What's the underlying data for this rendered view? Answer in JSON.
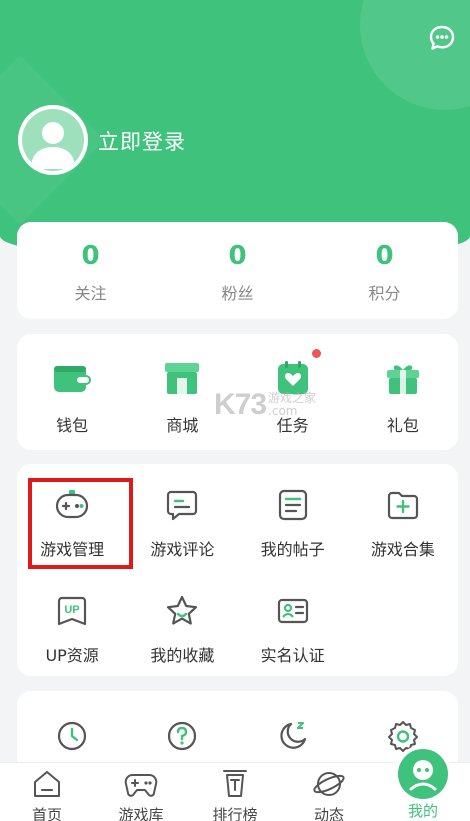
{
  "header": {
    "login_text": "立即登录",
    "accent_color": "#3ec27c",
    "message_icon": "chat-bubble-icon"
  },
  "stats": [
    {
      "value": "0",
      "label": "关注"
    },
    {
      "value": "0",
      "label": "粉丝"
    },
    {
      "value": "0",
      "label": "积分"
    }
  ],
  "wallet_row": [
    {
      "label": "钱包",
      "icon": "wallet-icon"
    },
    {
      "label": "商城",
      "icon": "shop-icon"
    },
    {
      "label": "任务",
      "icon": "task-icon",
      "badge_dot": true
    },
    {
      "label": "礼包",
      "icon": "gift-icon"
    }
  ],
  "tools": [
    {
      "label": "游戏管理",
      "icon": "gamepad-icon",
      "highlighted": true
    },
    {
      "label": "游戏评论",
      "icon": "comment-icon"
    },
    {
      "label": "我的帖子",
      "icon": "post-icon"
    },
    {
      "label": "游戏合集",
      "icon": "folder-add-icon"
    },
    {
      "label": "UP资源",
      "icon": "up-icon"
    },
    {
      "label": "我的收藏",
      "icon": "star-icon"
    },
    {
      "label": "实名认证",
      "icon": "id-card-icon"
    }
  ],
  "more_row": [
    {
      "icon": "clock-icon"
    },
    {
      "icon": "help-icon"
    },
    {
      "icon": "night-mode-icon"
    },
    {
      "icon": "settings-icon"
    }
  ],
  "watermark": {
    "brand": "K73",
    "line1": "游戏之家",
    "line2": ".com"
  },
  "tabbar": [
    {
      "label": "首页",
      "icon": "home-icon"
    },
    {
      "label": "游戏库",
      "icon": "gamepad-icon"
    },
    {
      "label": "排行榜",
      "icon": "rank-icon"
    },
    {
      "label": "动态",
      "icon": "planet-icon"
    },
    {
      "label": "我的",
      "icon": "profile-icon",
      "active": true
    }
  ]
}
